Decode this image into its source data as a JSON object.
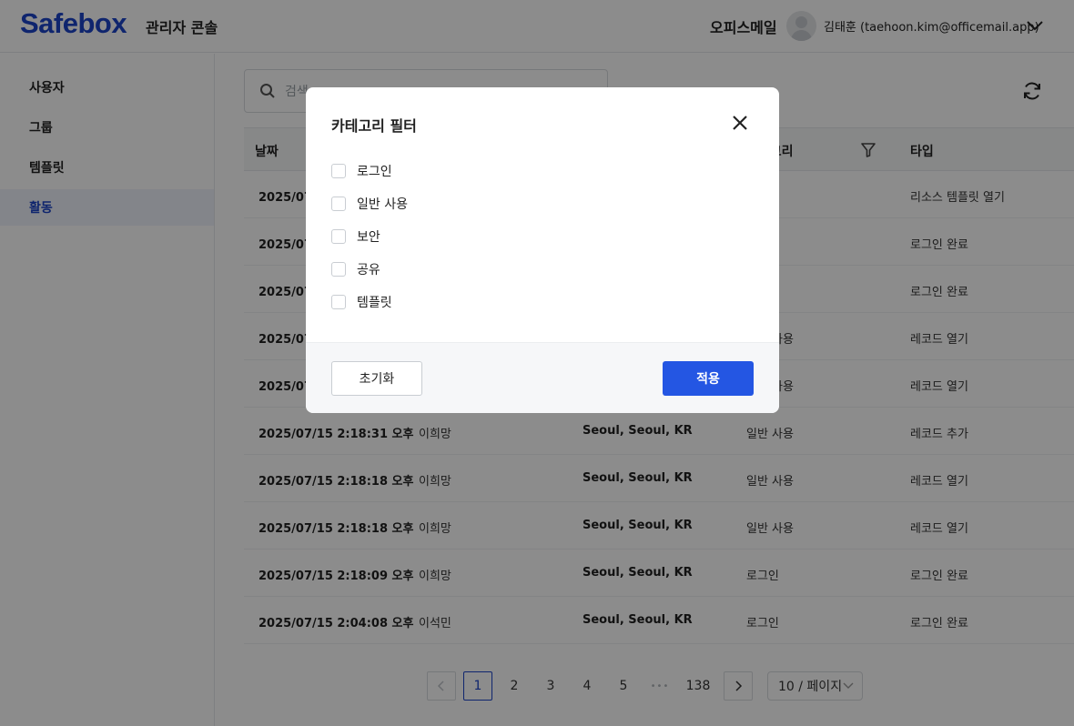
{
  "header": {
    "logo": "Safebox",
    "console_title": "관리자 콘솔",
    "org_name": "오피스메일",
    "user_label": "김태훈  (taehoon.kim@officemail.app)"
  },
  "sidebar": {
    "items": [
      {
        "label": "사용자"
      },
      {
        "label": "그룹"
      },
      {
        "label": "템플릿"
      },
      {
        "label": "활동",
        "active": true
      }
    ]
  },
  "search": {
    "placeholder": "검색",
    "value": ""
  },
  "table": {
    "columns": {
      "date": "날짜",
      "category": "카테고리",
      "type": "타입"
    },
    "rows": [
      {
        "date": "2025/07/15 2:20:41 오후",
        "user": "",
        "location": "",
        "category": "",
        "type": "리소스 템플릿 열기"
      },
      {
        "date": "2025/07/15 2:20:30 오후",
        "user": "",
        "location": "",
        "category": "",
        "type": "로그인 완료"
      },
      {
        "date": "2025/07/15 2:19:52 오후",
        "user": "",
        "location": "",
        "category": "",
        "type": "로그인 완료"
      },
      {
        "date": "2025/07/15 2:19:10 오후",
        "user": "",
        "location": "",
        "category": "일반 사용",
        "type": "레코드 열기"
      },
      {
        "date": "2025/07/15 2:18:44 오후",
        "user": "",
        "location": "",
        "category": "일반 사용",
        "type": "레코드 열기"
      },
      {
        "date": "2025/07/15 2:18:31 오후",
        "user": "이희망",
        "location": "Seoul, Seoul, KR",
        "category": "일반 사용",
        "type": "레코드 추가"
      },
      {
        "date": "2025/07/15 2:18:18 오후",
        "user": "이희망",
        "location": "Seoul, Seoul, KR",
        "category": "일반 사용",
        "type": "레코드 열기"
      },
      {
        "date": "2025/07/15 2:18:18 오후",
        "user": "이희망",
        "location": "Seoul, Seoul, KR",
        "category": "일반 사용",
        "type": "레코드 열기"
      },
      {
        "date": "2025/07/15 2:18:09 오후",
        "user": "이희망",
        "location": "Seoul, Seoul, KR",
        "category": "로그인",
        "type": "로그인 완료"
      },
      {
        "date": "2025/07/15 2:04:08 오후",
        "user": "이석민",
        "location": "Seoul, Seoul, KR",
        "category": "로그인",
        "type": "로그인 완료"
      }
    ]
  },
  "pagination": {
    "pages": [
      "1",
      "2",
      "3",
      "4",
      "5"
    ],
    "current": "1",
    "ellipsis": "•••",
    "last_page": "138",
    "page_size": "10 / 페이지"
  },
  "modal": {
    "title": "카테고리 필터",
    "options": [
      {
        "label": "로그인",
        "checked": false
      },
      {
        "label": "일반 사용",
        "checked": false
      },
      {
        "label": "보안",
        "checked": false
      },
      {
        "label": "공유",
        "checked": false
      },
      {
        "label": "템플릿",
        "checked": false
      }
    ],
    "reset_label": "초기화",
    "apply_label": "적용"
  },
  "colors": {
    "brand": "#1d44c9",
    "primary_button": "#2456e3",
    "overlay": "rgba(0,0,0,0.45)"
  },
  "icons": {
    "search": "search-icon",
    "refresh": "refresh-icon",
    "filter": "filter-icon",
    "close": "close-icon",
    "user_menu": "chevron-down-icon"
  }
}
